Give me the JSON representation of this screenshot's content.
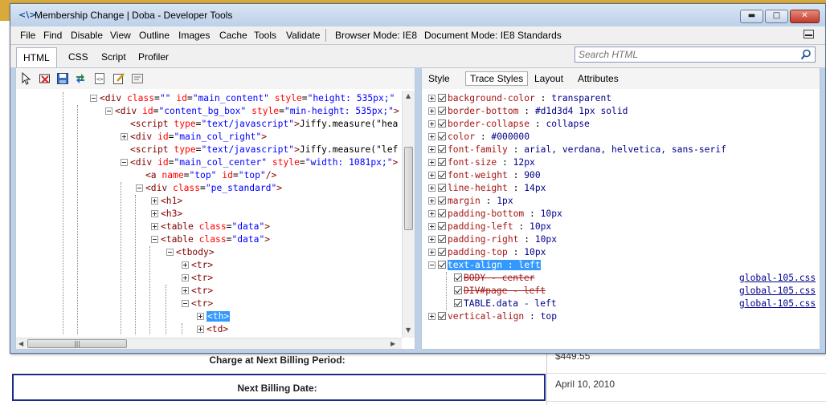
{
  "background": {
    "charge_label": "Charge at Next Billing Period:",
    "charge_value": "$449.55",
    "next_billing_label": "Next Billing Date:",
    "next_billing_value": "April 10, 2010"
  },
  "window": {
    "icon": "<\\>",
    "title": "Membership Change | Doba - Developer Tools",
    "min_glyph": "▬",
    "max_glyph": "□",
    "close_glyph": "✕"
  },
  "menu": {
    "items": [
      "File",
      "Find",
      "Disable",
      "View",
      "Outline",
      "Images",
      "Cache",
      "Tools",
      "Validate"
    ],
    "browser_mode": "Browser Mode: IE8",
    "document_mode": "Document Mode: IE8 Standards"
  },
  "tabs": {
    "items": [
      "HTML",
      "CSS",
      "Script",
      "Profiler"
    ],
    "active": "HTML"
  },
  "search": {
    "placeholder": "Search HTML"
  },
  "html_tree": {
    "lines": [
      {
        "indent": 0,
        "exp": "minus",
        "html": "<span class='tag'>&lt;div</span> <span class='attr'>class</span>=<span class='val'>\"\"</span> <span class='attr'>id</span>=<span class='val'>\"main_content\"</span> <span class='attr'>style</span>=<span class='val'>\"height: 535px;\"</span>"
      },
      {
        "indent": 1,
        "exp": "minus",
        "html": "<span class='tag'>&lt;div</span> <span class='attr'>id</span>=<span class='val'>\"content_bg_box\"</span> <span class='attr'>style</span>=<span class='val'>\"min-height: 535px;\"</span><span class='tag'>&gt;</span>"
      },
      {
        "indent": 2,
        "exp": "none",
        "html": "<span class='tag'>&lt;script</span> <span class='attr'>type</span>=<span class='val'>\"text/javascript\"</span><span class='tag'>&gt;</span><span class='txt'>Jiffy.measure(\"hea</span>"
      },
      {
        "indent": 2,
        "exp": "plus",
        "html": "<span class='tag'>&lt;div</span> <span class='attr'>id</span>=<span class='val'>\"main_col_right\"</span><span class='tag'>&gt;</span>"
      },
      {
        "indent": 2,
        "exp": "none",
        "html": "<span class='tag'>&lt;script</span> <span class='attr'>type</span>=<span class='val'>\"text/javascript\"</span><span class='tag'>&gt;</span><span class='txt'>Jiffy.measure(\"lef</span>"
      },
      {
        "indent": 2,
        "exp": "minus",
        "html": "<span class='tag'>&lt;div</span> <span class='attr'>id</span>=<span class='val'>\"main_col_center\"</span> <span class='attr'>style</span>=<span class='val'>\"width: 1081px;\"</span><span class='tag'>&gt;</span>"
      },
      {
        "indent": 3,
        "exp": "none",
        "html": "<span class='tag'>&lt;a</span> <span class='attr'>name</span>=<span class='val'>\"top\"</span> <span class='attr'>id</span>=<span class='val'>\"top\"</span><span class='tag'>/&gt;</span>"
      },
      {
        "indent": 3,
        "exp": "minus",
        "html": "<span class='tag'>&lt;div</span> <span class='attr'>class</span>=<span class='val'>\"pe_standard\"</span><span class='tag'>&gt;</span>"
      },
      {
        "indent": 4,
        "exp": "plus",
        "html": "<span class='tag'>&lt;h1&gt;</span>"
      },
      {
        "indent": 4,
        "exp": "plus",
        "html": "<span class='tag'>&lt;h3&gt;</span>"
      },
      {
        "indent": 4,
        "exp": "plus",
        "html": "<span class='tag'>&lt;table</span> <span class='attr'>class</span>=<span class='val'>\"data\"</span><span class='tag'>&gt;</span>"
      },
      {
        "indent": 4,
        "exp": "minus",
        "html": "<span class='tag'>&lt;table</span> <span class='attr'>class</span>=<span class='val'>\"data\"</span><span class='tag'>&gt;</span>"
      },
      {
        "indent": 5,
        "exp": "minus",
        "html": "<span class='tag'>&lt;tbody&gt;</span>"
      },
      {
        "indent": 6,
        "exp": "plus",
        "html": "<span class='tag'>&lt;tr&gt;</span>"
      },
      {
        "indent": 6,
        "exp": "plus",
        "html": "<span class='tag'>&lt;tr&gt;</span>"
      },
      {
        "indent": 6,
        "exp": "plus",
        "html": "<span class='tag'>&lt;tr&gt;</span>"
      },
      {
        "indent": 6,
        "exp": "minus",
        "html": "<span class='tag'>&lt;tr&gt;</span>"
      },
      {
        "indent": 7,
        "exp": "plus",
        "html": "<span class='sel'>&lt;th&gt;</span>"
      },
      {
        "indent": 7,
        "exp": "plus",
        "html": "<span class='tag'>&lt;td&gt;</span>"
      }
    ]
  },
  "style_tabs": {
    "items": [
      "Style",
      "Trace Styles",
      "Layout",
      "Attributes"
    ],
    "active": "Trace Styles"
  },
  "trace_styles": [
    {
      "prop": "background-color",
      "value": "transparent"
    },
    {
      "prop": "border-bottom",
      "value": "#d1d3d4 1px solid"
    },
    {
      "prop": "border-collapse",
      "value": "collapse"
    },
    {
      "prop": "color",
      "value": "#000000"
    },
    {
      "prop": "font-family",
      "value": "arial, verdana, helvetica, sans-serif"
    },
    {
      "prop": "font-size",
      "value": "12px"
    },
    {
      "prop": "font-weight",
      "value": "900"
    },
    {
      "prop": "line-height",
      "value": "14px"
    },
    {
      "prop": "margin",
      "value": "1px"
    },
    {
      "prop": "padding-bottom",
      "value": "10px"
    },
    {
      "prop": "padding-left",
      "value": "10px"
    },
    {
      "prop": "padding-right",
      "value": "10px"
    },
    {
      "prop": "padding-top",
      "value": "10px"
    },
    {
      "prop": "text-align",
      "value": "left",
      "selected": true
    },
    {
      "prop": "vertical-align",
      "value": "top"
    }
  ],
  "text_align_rules": [
    {
      "selector": "BODY",
      "value": "center",
      "struck": true,
      "file": "global-105.css"
    },
    {
      "selector": "DIV#page",
      "value": "left",
      "struck": true,
      "file": "global-105.css"
    },
    {
      "selector": "TABLE.data",
      "value": "left",
      "struck": false,
      "file": "global-105.css"
    }
  ],
  "colors": {
    "selection": "#3399ff",
    "tag": "#800000",
    "attr": "#ff0000",
    "attr_value": "#0000ff",
    "css_prop": "#a31515",
    "css_value": "#00008b",
    "title_bar": "#bcd0e8",
    "page_strip": "#d8a93b"
  },
  "icons": {
    "toolbar": [
      "select-element-icon",
      "clear-outline-icon",
      "save-icon",
      "refresh-icon",
      "dom-view-icon",
      "edit-icon",
      "word-wrap-icon"
    ],
    "search": "magnifier-icon"
  }
}
